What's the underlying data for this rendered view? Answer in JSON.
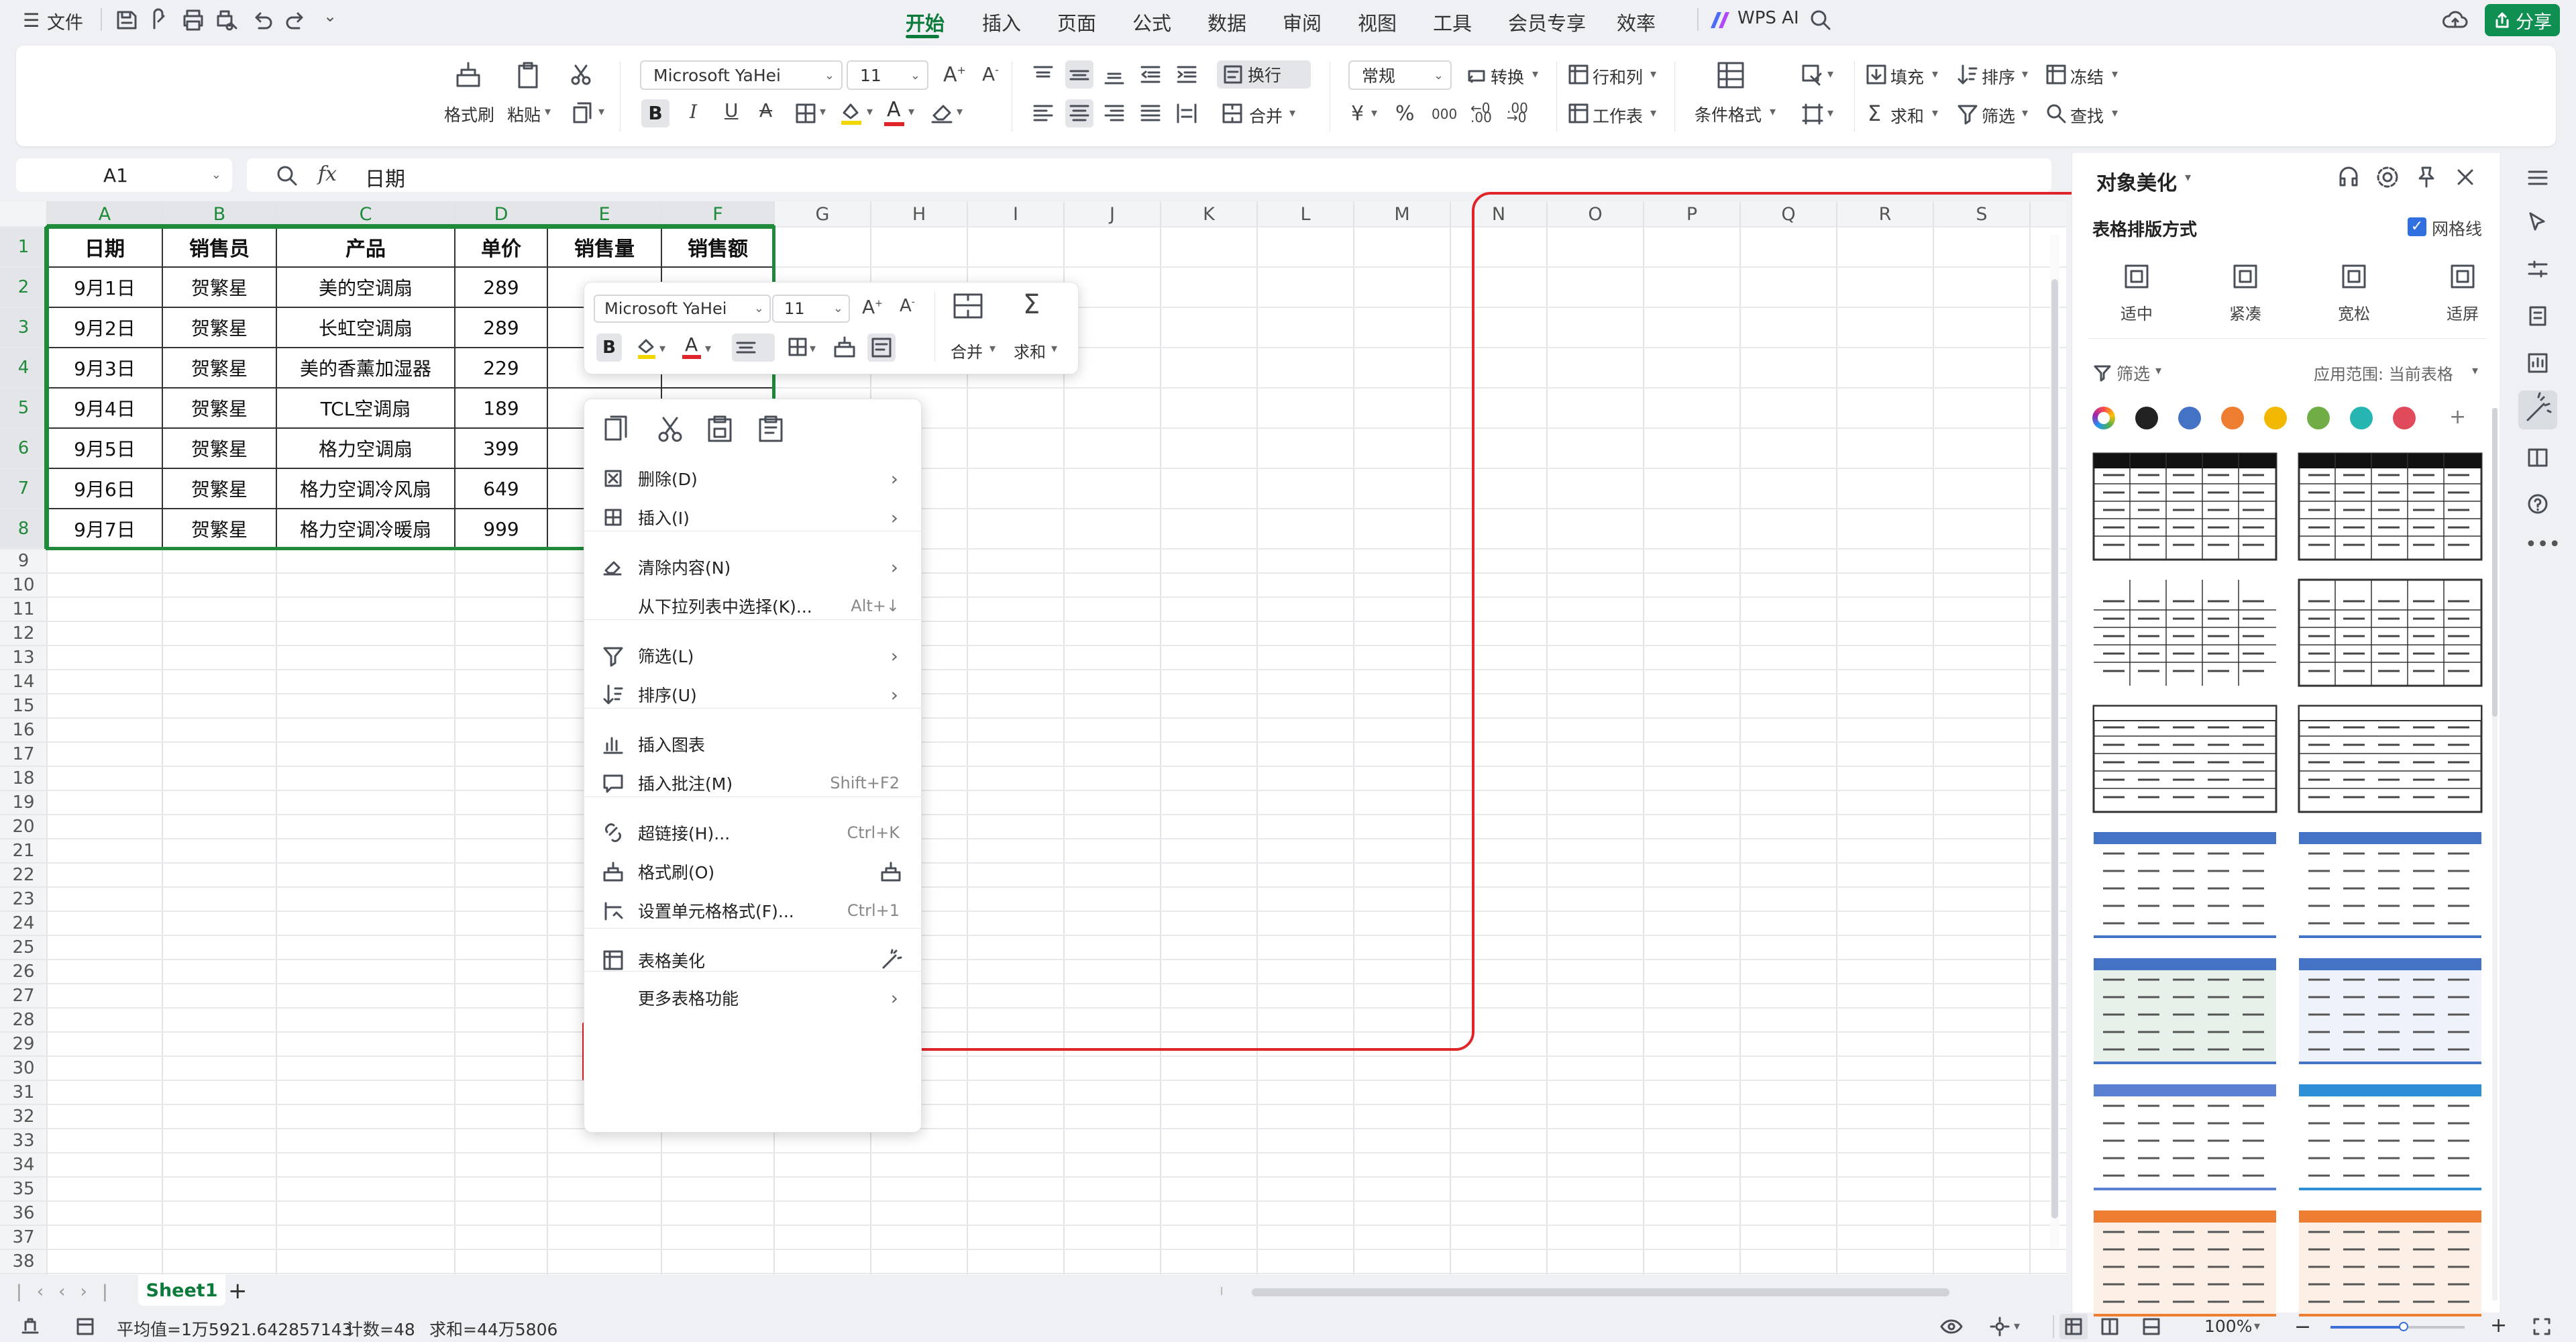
{
  "topbar": {
    "file_label": "文件",
    "tabs": [
      "开始",
      "插入",
      "页面",
      "公式",
      "数据",
      "审阅",
      "视图",
      "工具",
      "会员专享",
      "效率"
    ],
    "active_tab": "开始",
    "wps_ai_label": "WPS AI",
    "share_label": "分享"
  },
  "ribbon": {
    "format_painter": "格式刷",
    "paste": "粘贴",
    "font_name": "Microsoft YaHei",
    "font_size": "11",
    "wrap_text": "换行",
    "merge": "合并",
    "number_format": "常规",
    "convert": "转换",
    "rows_cols": "行和列",
    "worksheet": "工作表",
    "conditional_format": "条件格式",
    "fill": "填充",
    "sort": "排序",
    "freeze": "冻结",
    "sum": "求和",
    "filter": "筛选",
    "find": "查找",
    "currency_symbol": "¥",
    "percent_symbol": "%",
    "thousands_symbol": "000"
  },
  "formula_bar": {
    "name_box": "A1",
    "fx_label": "fx",
    "content": "日期"
  },
  "grid": {
    "columns": [
      "A",
      "B",
      "C",
      "D",
      "E",
      "F",
      "G",
      "H",
      "I",
      "J",
      "K",
      "L",
      "M",
      "N",
      "O",
      "P",
      "Q",
      "R",
      "S"
    ],
    "row_numbers": [
      "1",
      "2",
      "3",
      "4",
      "5",
      "6",
      "7",
      "8",
      "9",
      "10",
      "11",
      "12",
      "13",
      "14",
      "15",
      "16",
      "17",
      "18",
      "19",
      "20",
      "21",
      "22",
      "23",
      "24",
      "25",
      "26",
      "27",
      "28",
      "29",
      "30",
      "31",
      "32",
      "33",
      "34",
      "35",
      "36",
      "37",
      "38"
    ],
    "headers": [
      "日期",
      "销售员",
      "产品",
      "单价",
      "销售量",
      "销售额"
    ],
    "rows": [
      [
        "9月1日",
        "贺繁星",
        "美的空调扇",
        "289",
        "",
        ""
      ],
      [
        "9月2日",
        "贺繁星",
        "长虹空调扇",
        "289",
        "",
        ""
      ],
      [
        "9月3日",
        "贺繁星",
        "美的香薰加湿器",
        "229",
        "",
        ""
      ],
      [
        "9月4日",
        "贺繁星",
        "TCL空调扇",
        "189",
        "",
        ""
      ],
      [
        "9月5日",
        "贺繁星",
        "格力空调扇",
        "399",
        "",
        ""
      ],
      [
        "9月6日",
        "贺繁星",
        "格力空调冷风扇",
        "649",
        "",
        ""
      ],
      [
        "9月7日",
        "贺繁星",
        "格力空调冷暖扇",
        "999",
        "",
        ""
      ]
    ]
  },
  "sheet_tabs": {
    "active": "Sheet1",
    "add_label": "+"
  },
  "status": {
    "average": "平均值=1万5921.642857143",
    "count": "计数=48",
    "sum": "求和=44万5806",
    "zoom": "100%"
  },
  "mini_toolbar": {
    "font_name": "Microsoft YaHei",
    "font_size": "11",
    "merge": "合并",
    "sum": "求和"
  },
  "context_menu": {
    "items": [
      {
        "label": "删除(D)",
        "shortcut": "",
        "submenu": true
      },
      {
        "label": "插入(I)",
        "shortcut": "",
        "submenu": true
      },
      {
        "label": "清除内容(N)",
        "shortcut": "",
        "submenu": true
      },
      {
        "label": "从下拉列表中选择(K)...",
        "shortcut": "Alt+↓",
        "submenu": false
      },
      {
        "label": "筛选(L)",
        "shortcut": "",
        "submenu": true
      },
      {
        "label": "排序(U)",
        "shortcut": "",
        "submenu": true
      },
      {
        "label": "插入图表",
        "shortcut": "",
        "submenu": false
      },
      {
        "label": "插入批注(M)",
        "shortcut": "Shift+F2",
        "submenu": false
      },
      {
        "label": "超链接(H)...",
        "shortcut": "Ctrl+K",
        "submenu": false
      },
      {
        "label": "格式刷(O)",
        "shortcut": "",
        "submenu": false
      },
      {
        "label": "设置单元格格式(F)...",
        "shortcut": "Ctrl+1",
        "submenu": false
      },
      {
        "label": "表格美化",
        "shortcut": "",
        "submenu": false
      },
      {
        "label": "更多表格功能",
        "shortcut": "",
        "submenu": true
      }
    ],
    "highlighted": "表格美化"
  },
  "right_panel": {
    "title": "对象美化",
    "section_title": "表格排版方式",
    "gridlines_label": "网格线",
    "gridlines_checked": true,
    "layouts": [
      "适中",
      "紧凑",
      "宽松",
      "适屏"
    ],
    "filter_label": "筛选",
    "scope_label": "应用范围: 当前表格",
    "swatch_colors": [
      "#222222",
      "#4472c4",
      "#ed7d31",
      "#f2b800",
      "#70ad47",
      "#26b5b0",
      "#e04a5a"
    ],
    "template_colors": [
      "#111111",
      "#111111",
      "#333333",
      "#333333",
      "#444444",
      "#666666",
      "#4472c4",
      "#4472c4",
      "#4472c4",
      "#4472c4",
      "#5b7fd1",
      "#2e8fd6",
      "#ed7d31",
      "#ed7d31"
    ]
  },
  "colors": {
    "accent_green": "#0b7a3b",
    "selection_green": "#1f8a3a",
    "annotation_red": "#e0252a"
  }
}
